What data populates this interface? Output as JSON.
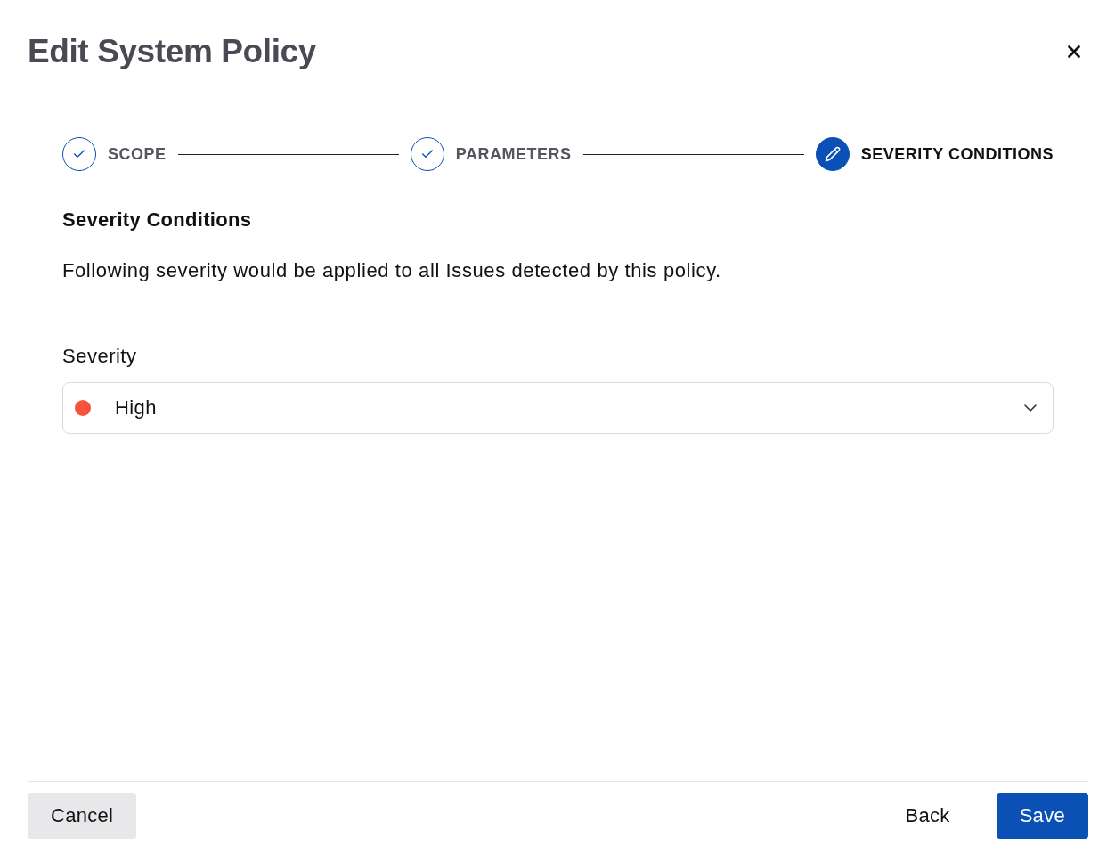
{
  "dialog": {
    "title": "Edit System Policy"
  },
  "steps": [
    {
      "label": "SCOPE",
      "completed": true,
      "selected": false
    },
    {
      "label": "PARAMETERS",
      "completed": true,
      "selected": false
    },
    {
      "label": "SEVERITY CONDITIONS",
      "completed": false,
      "selected": true
    }
  ],
  "section": {
    "heading": "Severity Conditions",
    "description": "Following severity would be applied to all Issues detected by this policy."
  },
  "severity_field": {
    "label": "Severity",
    "value": "High",
    "color": "#f5533d"
  },
  "footer": {
    "left_buttons": [
      {
        "label": "Cancel",
        "kind": "secondary"
      }
    ],
    "right_buttons": [
      {
        "label": "Back",
        "kind": "text"
      },
      {
        "label": "Save",
        "kind": "primary"
      }
    ]
  }
}
